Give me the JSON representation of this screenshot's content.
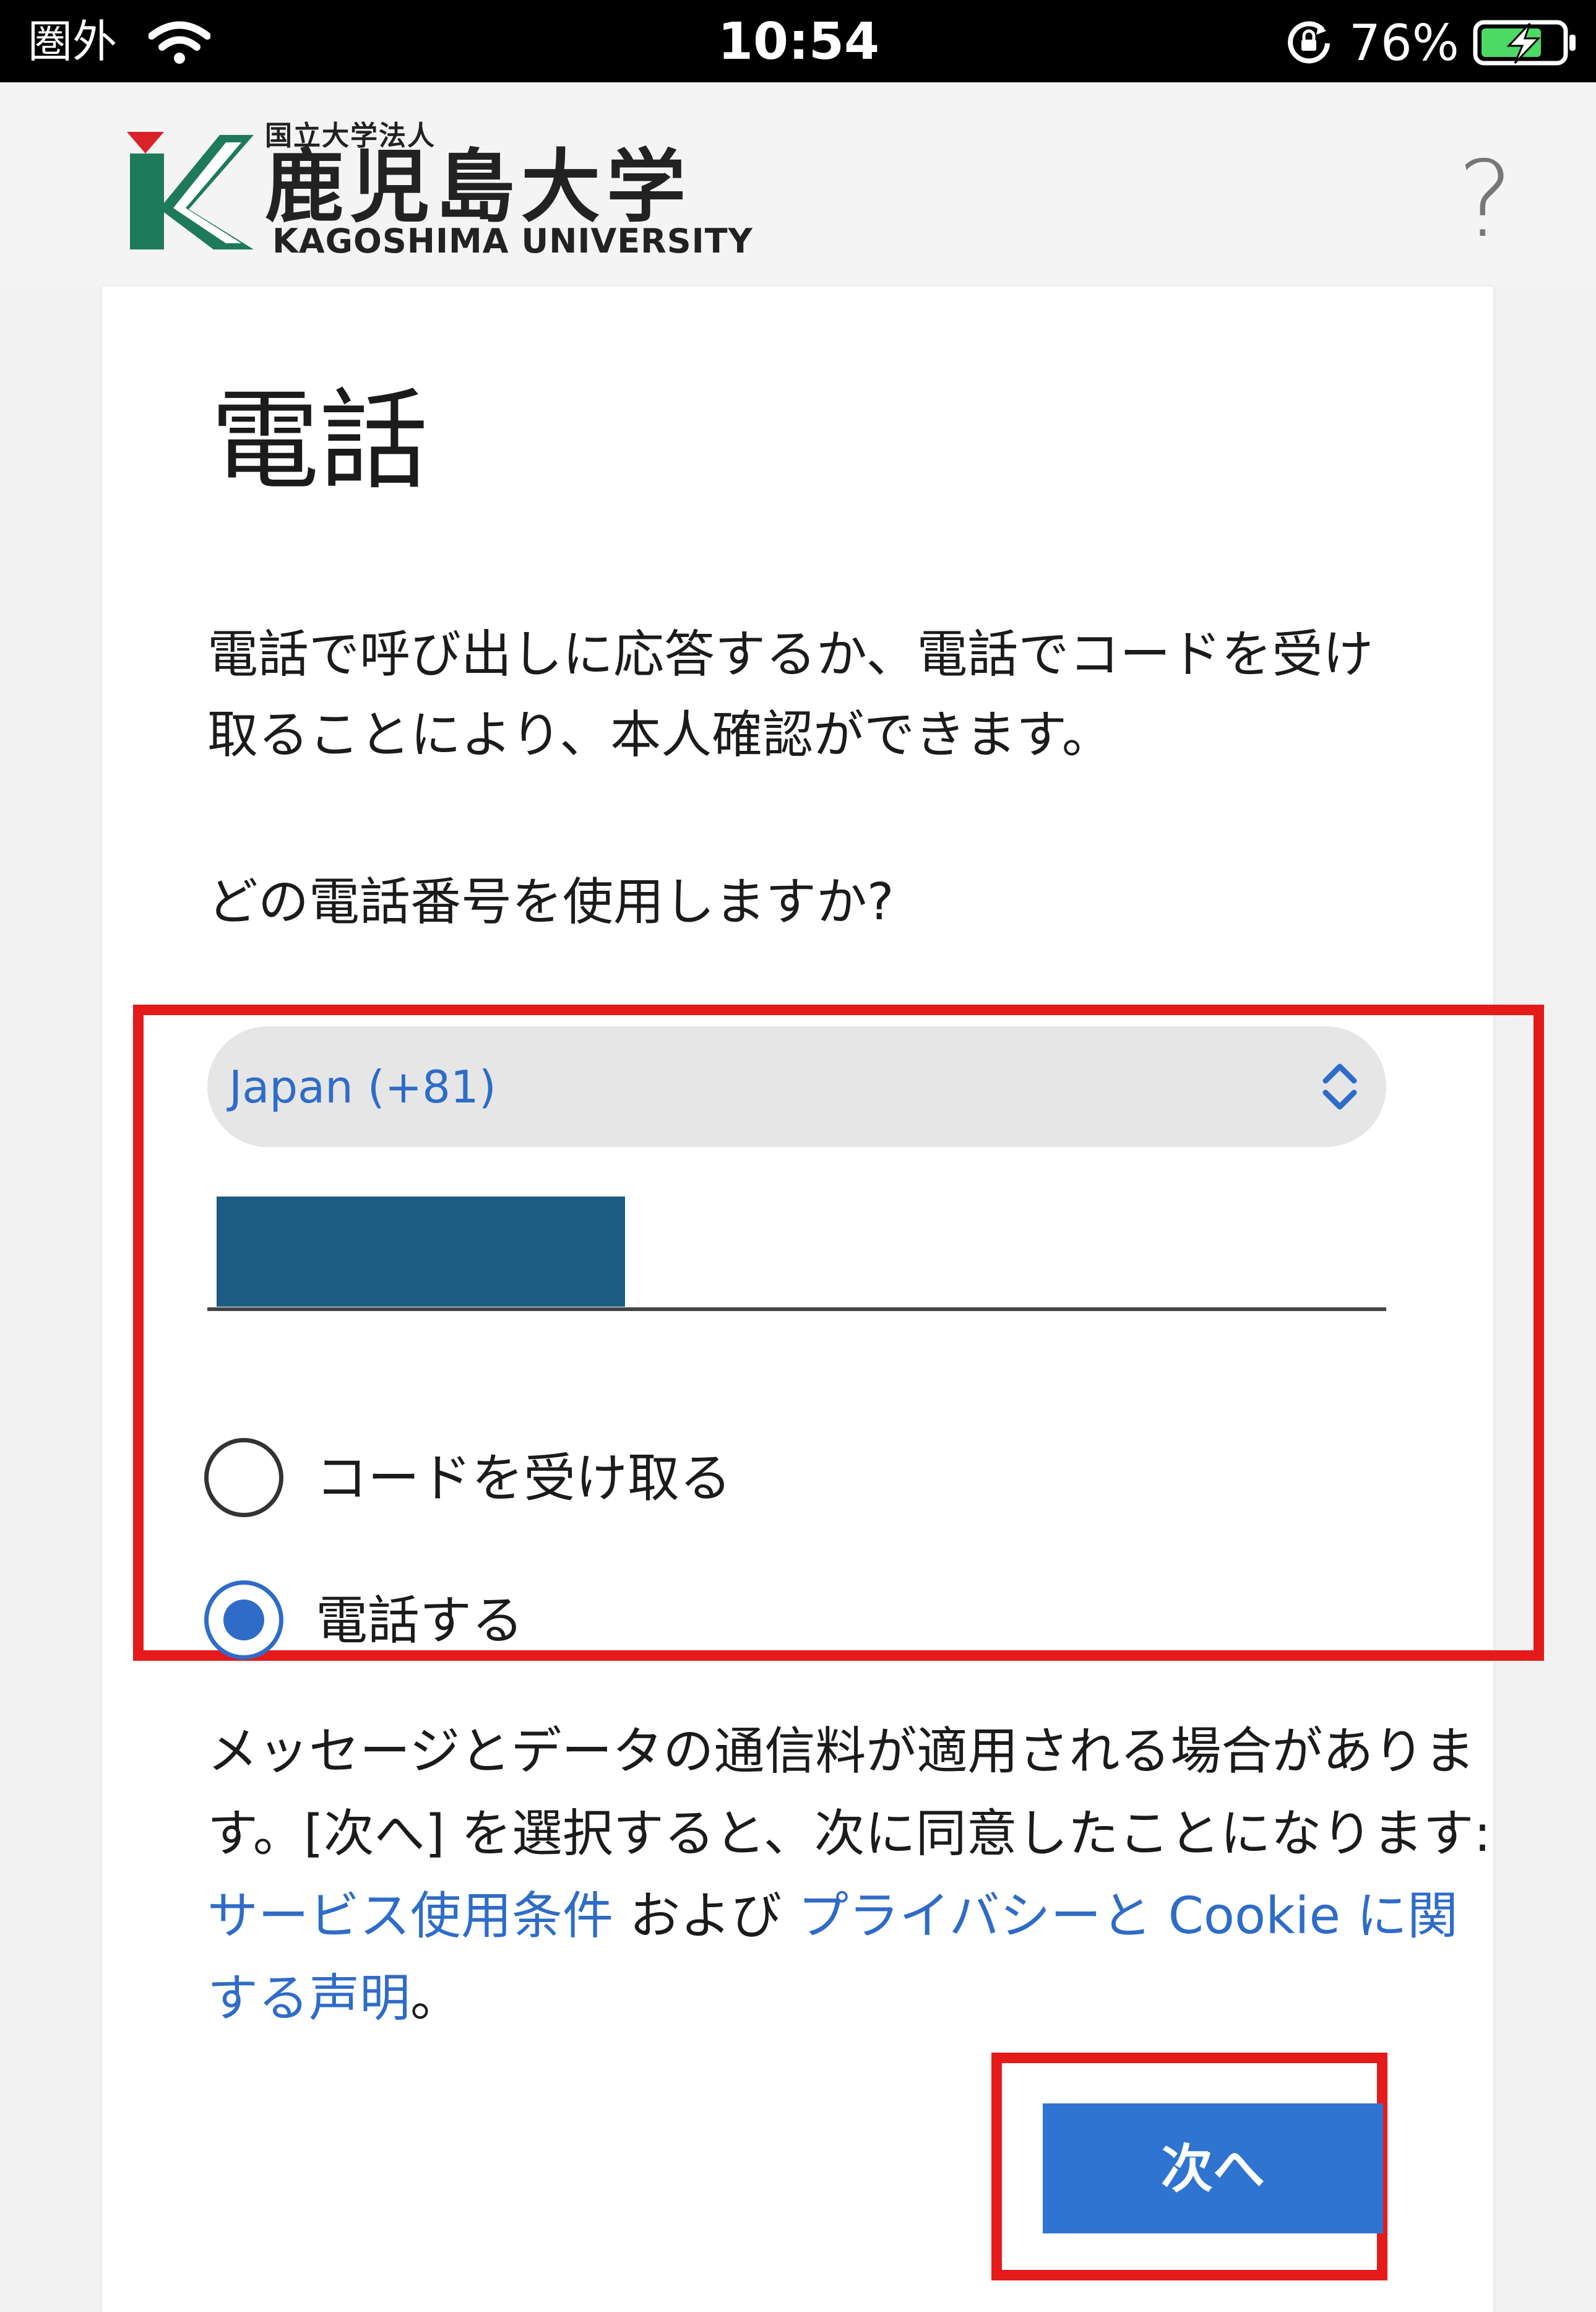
{
  "status_bar": {
    "carrier": "圏外",
    "time": "10:54",
    "battery_percent": "76%",
    "battery_level": 0.76,
    "icons": [
      "wifi-icon",
      "rotation-lock-icon",
      "battery-charging-icon"
    ]
  },
  "header": {
    "logo_top": "国立大学法人",
    "logo_main": "鹿児島大学",
    "logo_en": "KAGOSHIMA UNIVERSITY",
    "help_label": "?"
  },
  "card": {
    "title": "電話",
    "description": "電話で呼び出しに応答するか、電話でコードを受け取ることにより、本人確認ができます。",
    "question": "どの電話番号を使用しますか?",
    "country_select": {
      "value": "Japan (+81)"
    },
    "phone_input": {
      "value": ""
    },
    "options": {
      "receive_code": "コードを受け取る",
      "call_me": "電話する",
      "selected": "call_me"
    },
    "legal": {
      "text_before": "メッセージとデータの通信料が適用される場合があります。[次へ] を選択すると、次に同意したことになります: ",
      "terms_link": "サービス使用条件",
      "and": " および ",
      "privacy_link": "プライバシーと Cookie に関する声明",
      "period": "。"
    },
    "next_button": "次へ"
  },
  "colors": {
    "accent": "#2f6cc8",
    "button_bg": "#2f74d0",
    "annotation_red": "#e51b1b",
    "logo_green": "#1e7a5a",
    "logo_red": "#d8232a"
  }
}
